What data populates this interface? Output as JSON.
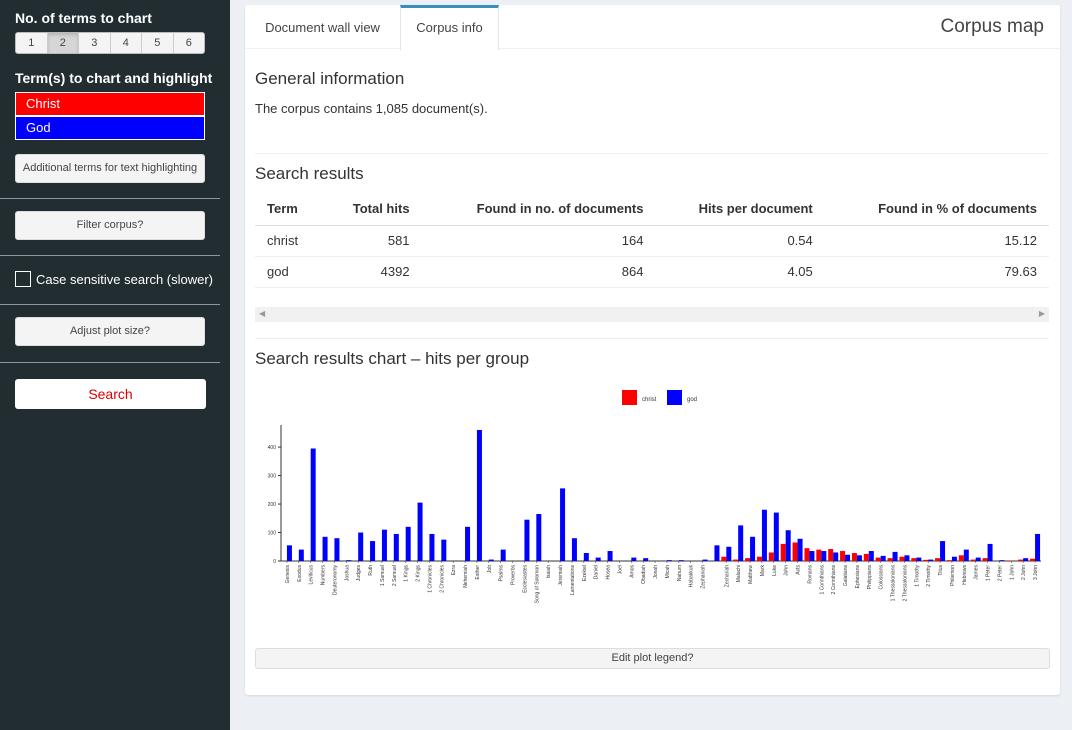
{
  "sidebar": {
    "terms_count_label": "No. of terms to chart",
    "term_count_options": [
      "1",
      "2",
      "3",
      "4",
      "5",
      "6"
    ],
    "term_count_selected": "2",
    "terms_label": "Term(s) to chart and highlight",
    "terms": [
      {
        "text": "Christ",
        "color": "#ff0000"
      },
      {
        "text": "God",
        "color": "#0000ff"
      }
    ],
    "additional_terms_button": "Additional terms for text highlighting",
    "filter_button": "Filter corpus?",
    "case_sensitive_label": "Case sensitive search (slower)",
    "adjust_plot_button": "Adjust plot size?",
    "search_button": "Search"
  },
  "panel": {
    "tabs": [
      "Document wall view",
      "Corpus info"
    ],
    "active_tab": "Corpus info",
    "title": "Corpus map",
    "general_heading": "General information",
    "general_text": "The corpus contains 1,085 document(s).",
    "results_heading": "Search results",
    "table": {
      "headers": [
        "Term",
        "Total hits",
        "Found in no. of documents",
        "Hits per document",
        "Found in % of documents"
      ],
      "rows": [
        [
          "christ",
          "581",
          "164",
          "0.54",
          "15.12"
        ],
        [
          "god",
          "4392",
          "864",
          "4.05",
          "79.63"
        ]
      ]
    },
    "chart_heading": "Search results chart – hits per group",
    "edit_legend_button": "Edit plot legend?"
  },
  "chart_data": {
    "type": "bar",
    "ylim": [
      0,
      460
    ],
    "yticks": [
      0,
      100,
      200,
      300,
      400
    ],
    "legend": {
      "position": "top-center"
    },
    "categories": [
      "Genesis",
      "Exodus",
      "Leviticus",
      "Numbers",
      "Deuteronomy",
      "Joshua",
      "Judges",
      "Ruth",
      "1 Samuel",
      "2 Samuel",
      "1 Kings",
      "2 Kings",
      "1 Chronicles",
      "2 Chronicles",
      "Ezra",
      "Nehemiah",
      "Esther",
      "Job",
      "Psalms",
      "Proverbs",
      "Ecclesiastes",
      "Song of Solomon",
      "Isaiah",
      "Jeremiah",
      "Lamentations",
      "Ezekiel",
      "Daniel",
      "Hosea",
      "Joel",
      "Amos",
      "Obadiah",
      "Jonah",
      "Micah",
      "Nahum",
      "Habakkuk",
      "Zephaniah",
      "Haggai",
      "Zechariah",
      "Malachi",
      "Matthew",
      "Mark",
      "Luke",
      "John",
      "Acts",
      "Romans",
      "1 Corinthians",
      "2 Corinthians",
      "Galatians",
      "Ephesians",
      "Philippians",
      "Colossians",
      "1 Thessalonians",
      "2 Thessalonians",
      "1 Timothy",
      "2 Timothy",
      "Titus",
      "Philemon",
      "Hebrews",
      "James",
      "1 Peter",
      "2 Peter",
      "1 John",
      "2 John",
      "3 John"
    ],
    "tick_labels_shown": [
      "Genesis",
      "Exodus",
      "Leviticus",
      "Numbers",
      "Deuteronomy",
      "Joshua",
      "Judges",
      "Ruth",
      "1 Samuel",
      "2 Samuel",
      "1 Kings",
      "2 Kings",
      "1 Chronicles",
      "2 Chronicles",
      "Ezra",
      "Nehemiah",
      "Esther",
      "Job",
      "Psalms",
      "Proverbs",
      "Ecclesiastes",
      "Song of Solomon",
      "Isaiah",
      "Jeremiah",
      "Lamentations",
      "Ezekiel",
      "Daniel",
      "Hosea",
      "Joel",
      "Amos",
      "Obadiah",
      "Jonah",
      "Micah",
      "Nahum",
      "Habakkuk",
      "Zephaniah",
      "Zechariah",
      "Malachi",
      "Matthew",
      "Mark",
      "Luke",
      "John",
      "Acts",
      "Romans",
      "1 Corinthians",
      "2 Corinthians",
      "Galatians",
      "Ephesians",
      "Philippians",
      "Colossians",
      "1 Thessalonians",
      "2 Thessalonians",
      "1 Timothy",
      "2 Timothy",
      "Titus",
      "Philemon",
      "Hebrews",
      "James",
      "1 Peter",
      "2 Peter",
      "1 John",
      "2 John",
      "3 John"
    ],
    "series": [
      {
        "name": "christ",
        "color": "#ff0000",
        "values": [
          0,
          0,
          0,
          0,
          0,
          0,
          0,
          0,
          0,
          0,
          0,
          0,
          0,
          0,
          0,
          0,
          0,
          0,
          0,
          0,
          0,
          0,
          0,
          0,
          0,
          0,
          0,
          0,
          0,
          0,
          0,
          0,
          0,
          0,
          0,
          0,
          0,
          15,
          5,
          10,
          15,
          30,
          60,
          65,
          45,
          40,
          42,
          35,
          28,
          25,
          12,
          10,
          15,
          10,
          4,
          10,
          3,
          20,
          5,
          10,
          0,
          2,
          5,
          8
        ]
      },
      {
        "name": "god",
        "color": "#0000ff",
        "values": [
          55,
          40,
          395,
          85,
          80,
          3,
          100,
          70,
          110,
          95,
          120,
          205,
          95,
          75,
          0,
          120,
          460,
          5,
          40,
          0,
          145,
          165,
          0,
          255,
          80,
          28,
          12,
          35,
          0,
          12,
          10,
          0,
          3,
          3,
          0,
          5,
          55,
          50,
          125,
          85,
          180,
          170,
          108,
          78,
          35,
          35,
          30,
          22,
          20,
          35,
          18,
          32,
          20,
          12,
          5,
          70,
          15,
          40,
          12,
          60,
          3,
          0,
          10,
          95
        ]
      }
    ]
  }
}
